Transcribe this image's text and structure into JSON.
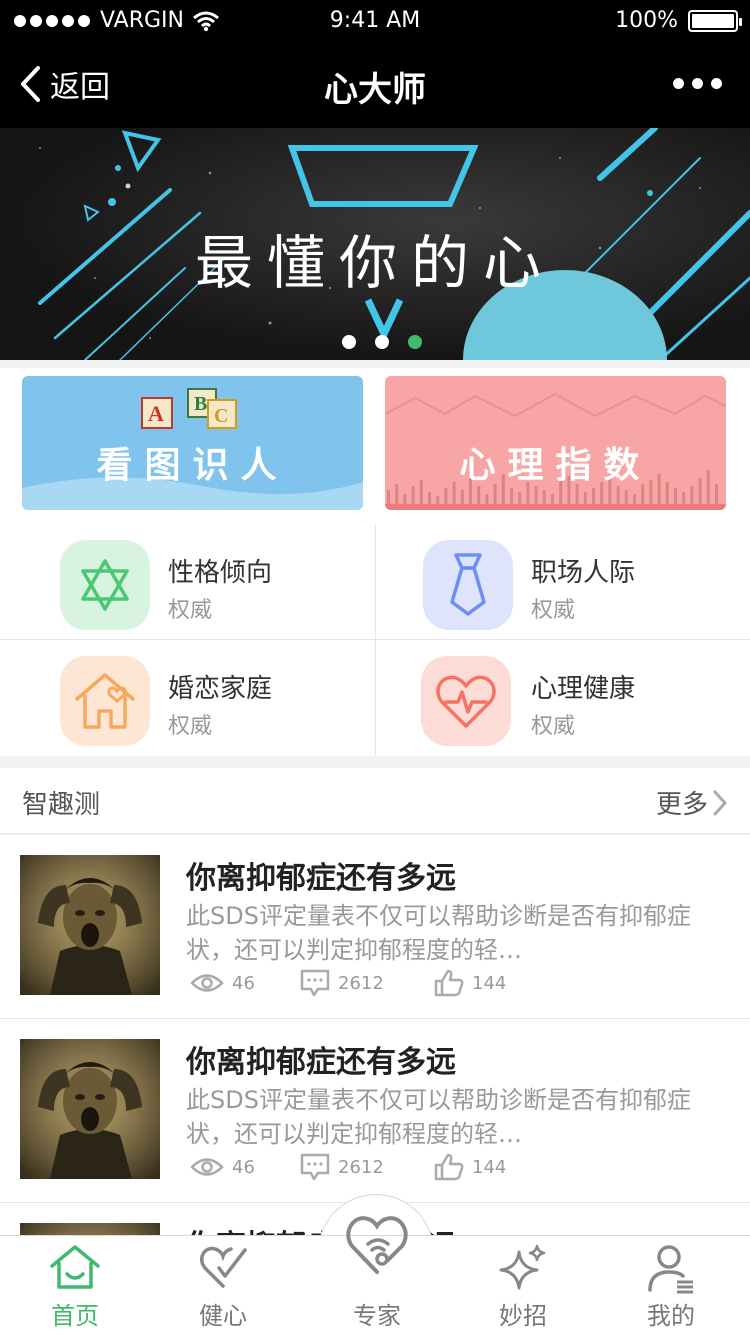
{
  "status": {
    "carrier": "VARGIN",
    "time": "9:41 AM",
    "battery": "100%"
  },
  "nav": {
    "back_label": "返回",
    "title": "心大师"
  },
  "banner": {
    "slogan": "最懂你的心",
    "pages": 3,
    "active_page": 3
  },
  "feature_cards": [
    {
      "label": "看图识人"
    },
    {
      "label": "心理指数"
    }
  ],
  "categories": [
    {
      "name": "性格倾向",
      "sub": "权威",
      "icon": "star-of-david-icon",
      "bg": "#d8f3df",
      "color": "#4cc774"
    },
    {
      "name": "职场人际",
      "sub": "权威",
      "icon": "tie-icon",
      "bg": "#dde4fb",
      "color": "#6d8ff2"
    },
    {
      "name": "婚恋家庭",
      "sub": "权威",
      "icon": "heart-house-icon",
      "bg": "#fde7d4",
      "color": "#f6a85c"
    },
    {
      "name": "心理健康",
      "sub": "权威",
      "icon": "heartbeat-icon",
      "bg": "#fddcd8",
      "color": "#f4745f"
    }
  ],
  "section": {
    "title": "智趣测",
    "more_label": "更多"
  },
  "articles": [
    {
      "title": "你离抑郁症还有多远",
      "desc": "此SDS评定量表不仅可以帮助诊断是否有抑郁症状，还可以判定抑郁程度的轻…",
      "views": "46",
      "comments": "2612",
      "likes": "144"
    },
    {
      "title": "你离抑郁症还有多远",
      "desc": "此SDS评定量表不仅可以帮助诊断是否有抑郁症状，还可以判定抑郁程度的轻…",
      "views": "46",
      "comments": "2612",
      "likes": "144"
    },
    {
      "title": "你离抑郁症还有多远",
      "desc": "",
      "views": "",
      "comments": "",
      "likes": ""
    }
  ],
  "tabs": [
    {
      "label": "首页",
      "icon": "home-icon",
      "active": true
    },
    {
      "label": "健心",
      "icon": "heart-check-icon",
      "active": false
    },
    {
      "label": "专家",
      "icon": "heart-wifi-icon",
      "active": false
    },
    {
      "label": "妙招",
      "icon": "sparkle-icon",
      "active": false
    },
    {
      "label": "我的",
      "icon": "user-icon",
      "active": false
    }
  ],
  "colors": {
    "accent": "#3fb96e",
    "header_bg": "#000000",
    "card_blue": "#80c4ee",
    "card_pink": "#f7a5a5"
  }
}
